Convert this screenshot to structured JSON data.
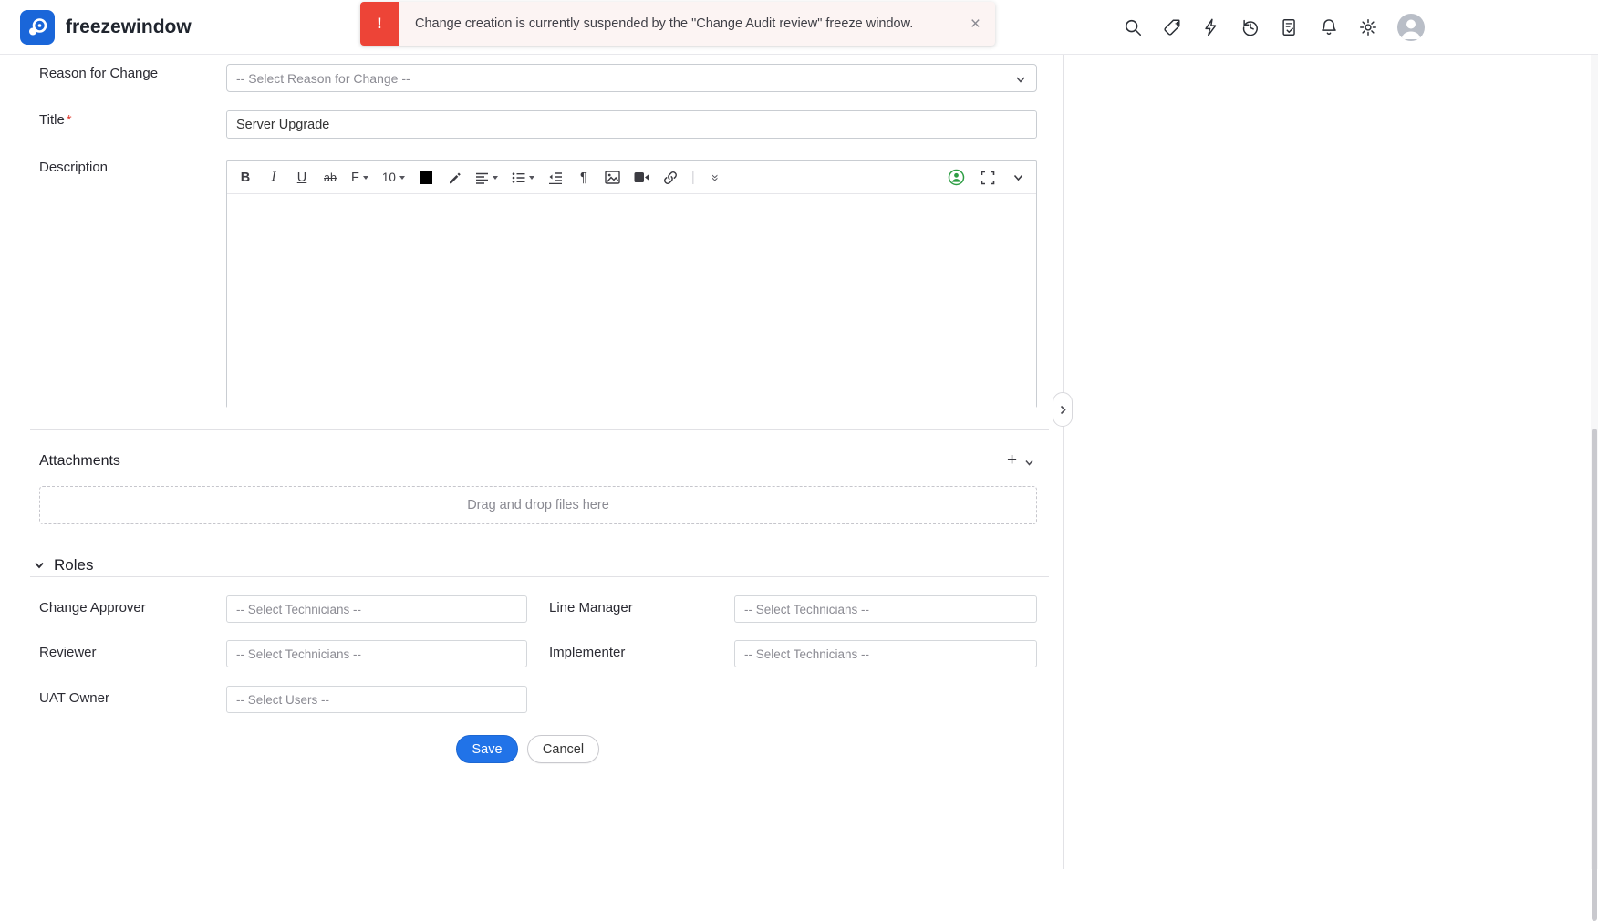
{
  "colors": {
    "accent": "#2173e8",
    "logo_blue": "#1a66d9",
    "toast_red": "#ed4437",
    "toast_bg": "#fcf4f3"
  },
  "header": {
    "app_name": "freezewindow",
    "icons": [
      "search-icon",
      "release-tag-icon",
      "quick-actions-icon",
      "history-icon",
      "approvals-icon",
      "notifications-icon",
      "settings-icon",
      "avatar"
    ],
    "toast": {
      "alert_glyph": "!",
      "message": "Change creation is currently suspended by the \"Change Audit review\" freeze window.",
      "close_glyph": "×"
    }
  },
  "form": {
    "reason": {
      "label": "Reason for Change",
      "value": "-- Select Reason for Change --"
    },
    "title": {
      "label": "Title",
      "required": "*",
      "value": "Server Upgrade"
    },
    "description": {
      "label": "Description"
    },
    "editor": {
      "glyphs": {
        "bold": "B",
        "italic": "I",
        "underline": "U",
        "strike": "ab",
        "font": "F",
        "size": "10",
        "paragraph": "¶",
        "more": "»",
        "separator": "|"
      },
      "icons": [
        "bold",
        "italic",
        "underline",
        "strikethrough",
        "font-family",
        "font-size",
        "font-color",
        "highlight-pen",
        "align",
        "list",
        "outdent",
        "paragraph",
        "insert-image",
        "insert-video",
        "insert-link",
        "more-tools",
        "mention-user",
        "fullscreen",
        "toolbar-expand"
      ]
    },
    "attachments": {
      "label": "Attachments",
      "add_glyph": "+",
      "dropzone_text": "Drag and drop files here"
    },
    "roles": {
      "title": "Roles",
      "fields": [
        {
          "label": "Change Approver",
          "placeholder": "-- Select Technicians --"
        },
        {
          "label": "Line Manager",
          "placeholder": "-- Select Technicians --"
        },
        {
          "label": "Reviewer",
          "placeholder": "-- Select Technicians --"
        },
        {
          "label": "Implementer",
          "placeholder": "-- Select Technicians --"
        },
        {
          "label": "UAT Owner",
          "placeholder": "-- Select Users --"
        }
      ]
    },
    "actions": {
      "save": "Save",
      "cancel": "Cancel"
    }
  }
}
